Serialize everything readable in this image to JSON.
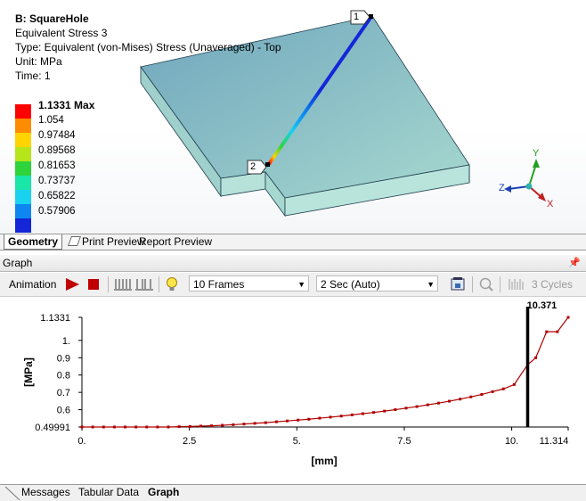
{
  "viewport": {
    "title": "B: SquareHole",
    "result": "Equivalent Stress 3",
    "type": "Type: Equivalent (von-Mises) Stress (Unaveraged) - Top",
    "unit": "Unit: MPa",
    "time": "Time: 1",
    "legend": [
      {
        "label": "1.1331 Max",
        "color": "#ff0000"
      },
      {
        "label": "1.054",
        "color": "#ff8c00"
      },
      {
        "label": "0.97484",
        "color": "#ffd400"
      },
      {
        "label": "0.89568",
        "color": "#b6e619"
      },
      {
        "label": "0.81653",
        "color": "#2ed43c"
      },
      {
        "label": "0.73737",
        "color": "#19e6a8"
      },
      {
        "label": "0.65822",
        "color": "#19d2f0"
      },
      {
        "label": "0.57906",
        "color": "#0d86f0"
      },
      {
        "label": "",
        "color": "#1426d8"
      }
    ],
    "path_points": [
      "1",
      "2"
    ],
    "triad": {
      "x": "X",
      "y": "Y",
      "z": "Z"
    }
  },
  "viewport_tabs": [
    "Geometry",
    "Print Preview",
    "Report Preview"
  ],
  "graph_panel": {
    "title": "Graph",
    "toolbar": {
      "animation_label": "Animation",
      "frames": "10 Frames",
      "duration": "2 Sec (Auto)",
      "cycles": "3 Cycles"
    }
  },
  "chart_data": {
    "type": "line",
    "xlabel": "[mm]",
    "ylabel": "[MPa]",
    "xlim": [
      0,
      11.314
    ],
    "ylim": [
      0.49991,
      1.1331
    ],
    "x_ticks": [
      "0.",
      "2.5",
      "5.",
      "7.5",
      "10.",
      "11.314"
    ],
    "y_ticks": [
      "0.49991",
      "0.6",
      "0.7",
      "0.8",
      "0.9",
      "1.",
      "1.1331"
    ],
    "cursor_x": 10.371,
    "cursor_label": "10.371",
    "series": [
      {
        "color": "#b00000",
        "x": [
          0,
          0.2514,
          0.5028,
          0.7543,
          1.0057,
          1.2571,
          1.5085,
          1.7599,
          2.0114,
          2.2628,
          2.5142,
          2.7656,
          3.017,
          3.2685,
          3.5199,
          3.7713,
          4.0227,
          4.2741,
          4.5256,
          4.777,
          5.0284,
          5.2798,
          5.5312,
          5.7827,
          6.0341,
          6.2855,
          6.5369,
          6.7883,
          7.0398,
          7.2912,
          7.5426,
          7.794,
          8.0454,
          8.2969,
          8.5483,
          8.7997,
          9.0511,
          9.3025,
          9.554,
          9.8054,
          10.057,
          10.371,
          10.56,
          10.812,
          11.063,
          11.314
        ],
        "y": [
          0.5,
          0.5,
          0.5,
          0.5,
          0.5,
          0.5,
          0.5,
          0.5,
          0.5,
          0.502,
          0.503,
          0.505,
          0.507,
          0.51,
          0.513,
          0.517,
          0.521,
          0.525,
          0.53,
          0.535,
          0.54,
          0.545,
          0.551,
          0.557,
          0.563,
          0.57,
          0.577,
          0.584,
          0.592,
          0.6,
          0.609,
          0.618,
          0.628,
          0.638,
          0.649,
          0.661,
          0.674,
          0.688,
          0.704,
          0.72,
          0.745,
          0.86,
          0.9,
          1.05,
          1.05,
          1.1331
        ]
      }
    ]
  },
  "bottom_tabs": [
    "Messages",
    "Tabular Data",
    "Graph"
  ]
}
